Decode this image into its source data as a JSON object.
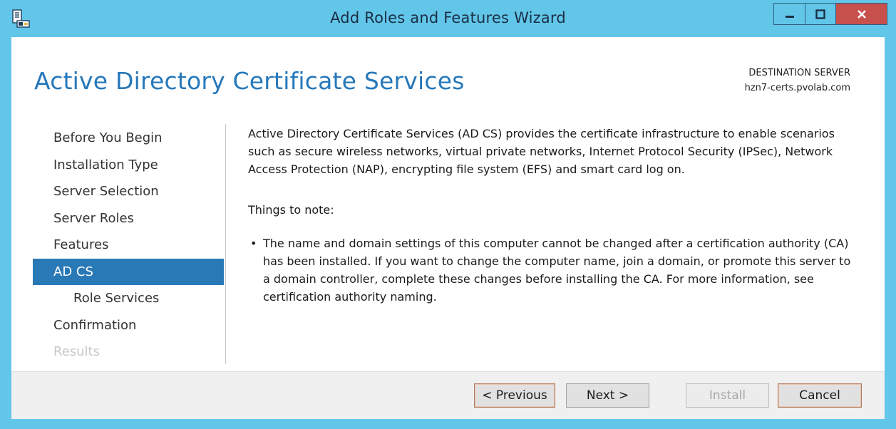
{
  "window": {
    "title": "Add Roles and Features Wizard",
    "icon": "server-manager-icon",
    "controls": {
      "minimize": "minimize-icon",
      "maximize": "maximize-icon",
      "close": "close-icon"
    }
  },
  "header": {
    "page_title": "Active Directory Certificate Services",
    "destination_label": "DESTINATION SERVER",
    "destination_server": "hzn7-certs.pvolab.com"
  },
  "nav": {
    "items": [
      {
        "label": "Before You Begin",
        "state": "normal"
      },
      {
        "label": "Installation Type",
        "state": "normal"
      },
      {
        "label": "Server Selection",
        "state": "normal"
      },
      {
        "label": "Server Roles",
        "state": "normal"
      },
      {
        "label": "Features",
        "state": "normal"
      },
      {
        "label": "AD CS",
        "state": "active"
      },
      {
        "label": "Role Services",
        "state": "sub"
      },
      {
        "label": "Confirmation",
        "state": "normal"
      },
      {
        "label": "Results",
        "state": "disabled"
      }
    ]
  },
  "main": {
    "intro": "Active Directory Certificate Services (AD CS) provides the certificate infrastructure to enable scenarios such as secure wireless networks, virtual private networks, Internet Protocol Security (IPSec), Network Access Protection (NAP), encrypting file system (EFS) and smart card log on.",
    "note_heading": "Things to note:",
    "bullet_char": "•",
    "bullets": [
      "The name and domain settings of this computer cannot be changed after a certification authority (CA) has been installed. If you want to change the computer name, join a domain, or promote this server to a domain controller, complete these changes before installing the CA. For more information, see certification authority naming."
    ]
  },
  "footer": {
    "previous_label": "< Previous",
    "next_label": "Next >",
    "install_label": "Install",
    "cancel_label": "Cancel"
  },
  "colors": {
    "frame": "#62c6e9",
    "accent": "#2678ba",
    "active_nav": "#2a79b7",
    "close_button": "#c7504c",
    "footer_bg": "#f0f0f0"
  }
}
